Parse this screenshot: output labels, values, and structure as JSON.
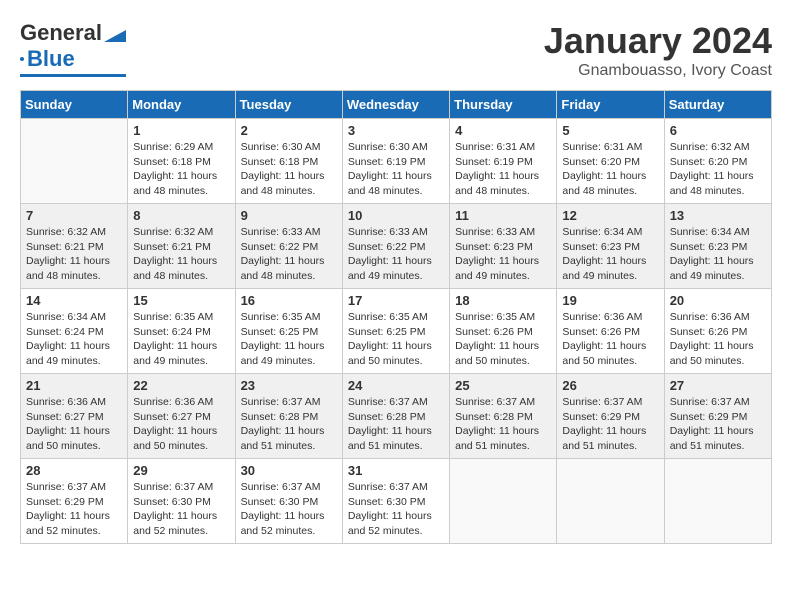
{
  "header": {
    "logo_general": "General",
    "logo_blue": "Blue",
    "month": "January 2024",
    "location": "Gnambouasso, Ivory Coast"
  },
  "weekdays": [
    "Sunday",
    "Monday",
    "Tuesday",
    "Wednesday",
    "Thursday",
    "Friday",
    "Saturday"
  ],
  "weeks": [
    [
      {
        "day": "",
        "sunrise": "",
        "sunset": "",
        "daylight": ""
      },
      {
        "day": "1",
        "sunrise": "6:29 AM",
        "sunset": "6:18 PM",
        "daylight": "11 hours and 48 minutes."
      },
      {
        "day": "2",
        "sunrise": "6:30 AM",
        "sunset": "6:18 PM",
        "daylight": "11 hours and 48 minutes."
      },
      {
        "day": "3",
        "sunrise": "6:30 AM",
        "sunset": "6:19 PM",
        "daylight": "11 hours and 48 minutes."
      },
      {
        "day": "4",
        "sunrise": "6:31 AM",
        "sunset": "6:19 PM",
        "daylight": "11 hours and 48 minutes."
      },
      {
        "day": "5",
        "sunrise": "6:31 AM",
        "sunset": "6:20 PM",
        "daylight": "11 hours and 48 minutes."
      },
      {
        "day": "6",
        "sunrise": "6:32 AM",
        "sunset": "6:20 PM",
        "daylight": "11 hours and 48 minutes."
      }
    ],
    [
      {
        "day": "7",
        "sunrise": "6:32 AM",
        "sunset": "6:21 PM",
        "daylight": "11 hours and 48 minutes."
      },
      {
        "day": "8",
        "sunrise": "6:32 AM",
        "sunset": "6:21 PM",
        "daylight": "11 hours and 48 minutes."
      },
      {
        "day": "9",
        "sunrise": "6:33 AM",
        "sunset": "6:22 PM",
        "daylight": "11 hours and 48 minutes."
      },
      {
        "day": "10",
        "sunrise": "6:33 AM",
        "sunset": "6:22 PM",
        "daylight": "11 hours and 49 minutes."
      },
      {
        "day": "11",
        "sunrise": "6:33 AM",
        "sunset": "6:23 PM",
        "daylight": "11 hours and 49 minutes."
      },
      {
        "day": "12",
        "sunrise": "6:34 AM",
        "sunset": "6:23 PM",
        "daylight": "11 hours and 49 minutes."
      },
      {
        "day": "13",
        "sunrise": "6:34 AM",
        "sunset": "6:23 PM",
        "daylight": "11 hours and 49 minutes."
      }
    ],
    [
      {
        "day": "14",
        "sunrise": "6:34 AM",
        "sunset": "6:24 PM",
        "daylight": "11 hours and 49 minutes."
      },
      {
        "day": "15",
        "sunrise": "6:35 AM",
        "sunset": "6:24 PM",
        "daylight": "11 hours and 49 minutes."
      },
      {
        "day": "16",
        "sunrise": "6:35 AM",
        "sunset": "6:25 PM",
        "daylight": "11 hours and 49 minutes."
      },
      {
        "day": "17",
        "sunrise": "6:35 AM",
        "sunset": "6:25 PM",
        "daylight": "11 hours and 50 minutes."
      },
      {
        "day": "18",
        "sunrise": "6:35 AM",
        "sunset": "6:26 PM",
        "daylight": "11 hours and 50 minutes."
      },
      {
        "day": "19",
        "sunrise": "6:36 AM",
        "sunset": "6:26 PM",
        "daylight": "11 hours and 50 minutes."
      },
      {
        "day": "20",
        "sunrise": "6:36 AM",
        "sunset": "6:26 PM",
        "daylight": "11 hours and 50 minutes."
      }
    ],
    [
      {
        "day": "21",
        "sunrise": "6:36 AM",
        "sunset": "6:27 PM",
        "daylight": "11 hours and 50 minutes."
      },
      {
        "day": "22",
        "sunrise": "6:36 AM",
        "sunset": "6:27 PM",
        "daylight": "11 hours and 50 minutes."
      },
      {
        "day": "23",
        "sunrise": "6:37 AM",
        "sunset": "6:28 PM",
        "daylight": "11 hours and 51 minutes."
      },
      {
        "day": "24",
        "sunrise": "6:37 AM",
        "sunset": "6:28 PM",
        "daylight": "11 hours and 51 minutes."
      },
      {
        "day": "25",
        "sunrise": "6:37 AM",
        "sunset": "6:28 PM",
        "daylight": "11 hours and 51 minutes."
      },
      {
        "day": "26",
        "sunrise": "6:37 AM",
        "sunset": "6:29 PM",
        "daylight": "11 hours and 51 minutes."
      },
      {
        "day": "27",
        "sunrise": "6:37 AM",
        "sunset": "6:29 PM",
        "daylight": "11 hours and 51 minutes."
      }
    ],
    [
      {
        "day": "28",
        "sunrise": "6:37 AM",
        "sunset": "6:29 PM",
        "daylight": "11 hours and 52 minutes."
      },
      {
        "day": "29",
        "sunrise": "6:37 AM",
        "sunset": "6:30 PM",
        "daylight": "11 hours and 52 minutes."
      },
      {
        "day": "30",
        "sunrise": "6:37 AM",
        "sunset": "6:30 PM",
        "daylight": "11 hours and 52 minutes."
      },
      {
        "day": "31",
        "sunrise": "6:37 AM",
        "sunset": "6:30 PM",
        "daylight": "11 hours and 52 minutes."
      },
      {
        "day": "",
        "sunrise": "",
        "sunset": "",
        "daylight": ""
      },
      {
        "day": "",
        "sunrise": "",
        "sunset": "",
        "daylight": ""
      },
      {
        "day": "",
        "sunrise": "",
        "sunset": "",
        "daylight": ""
      }
    ]
  ],
  "labels": {
    "sunrise": "Sunrise:",
    "sunset": "Sunset:",
    "daylight": "Daylight:"
  }
}
